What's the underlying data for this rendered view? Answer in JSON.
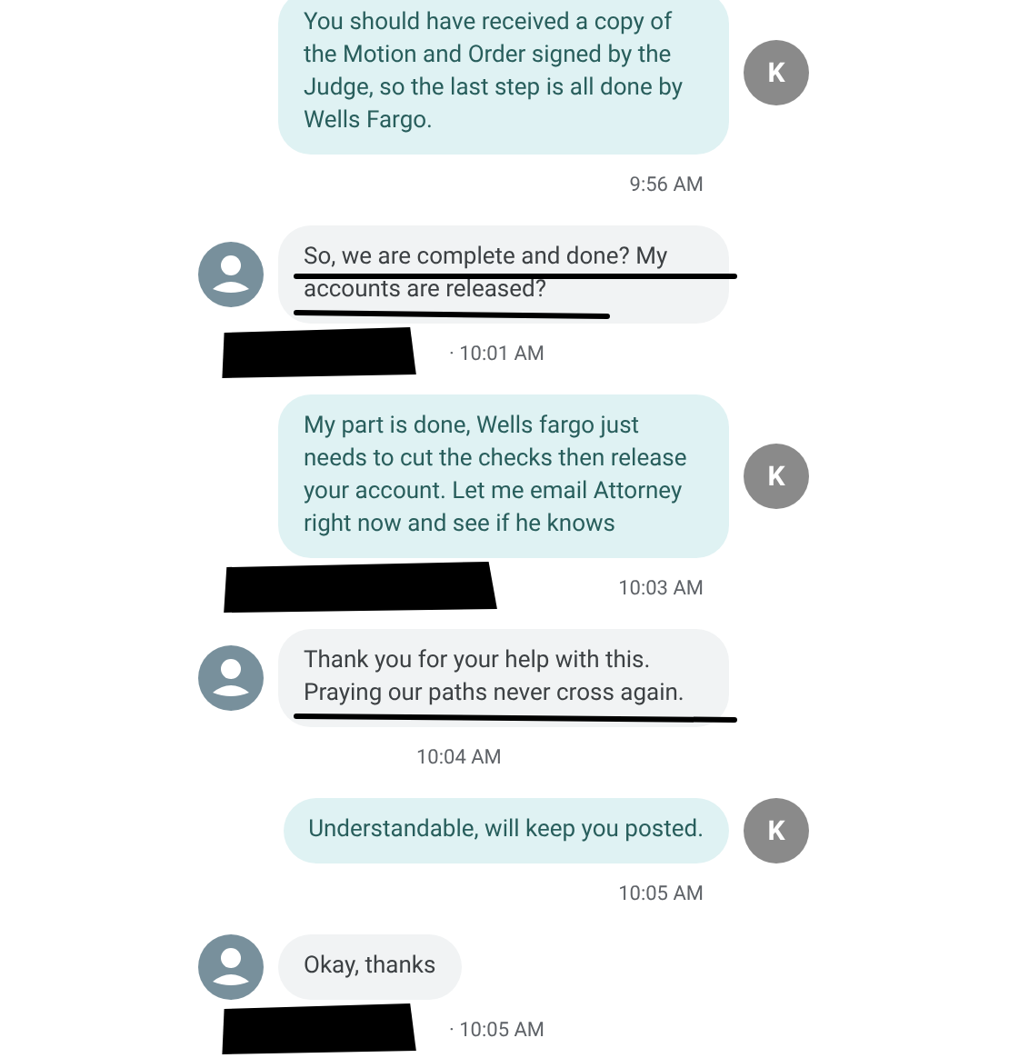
{
  "messages": [
    {
      "kind": "outgoing",
      "text": "You should have received a copy of the Motion and Order signed by the Judge, so the last step is all done by Wells Fargo.",
      "avatar": "K",
      "time": "9:56 AM",
      "redacted": false,
      "underline_first_line": false,
      "underline_last_line": false
    },
    {
      "kind": "incoming",
      "text": "So, we are complete and done? My accounts are released?",
      "time": "· 10:01 AM",
      "redacted": true,
      "underline_first_line": true,
      "underline_last_line": true
    },
    {
      "kind": "outgoing",
      "text": "My part is done, Wells fargo just needs to cut the checks then release your account. Let me email Attorney right now and see if he knows",
      "avatar": "K",
      "time": "10:03 AM",
      "redacted": true,
      "underline_first_line": false,
      "underline_last_line": false
    },
    {
      "kind": "incoming",
      "text": "Thank you for your help with this. Praying our paths never cross again.",
      "time": "10:04 AM",
      "redacted": false,
      "underline_first_line": false,
      "underline_last_line": true
    },
    {
      "kind": "outgoing",
      "text": "Understandable, will keep you posted.",
      "avatar": "K",
      "time": "10:05 AM",
      "redacted": false,
      "underline_first_line": false,
      "underline_last_line": false
    },
    {
      "kind": "incoming",
      "text": "Okay, thanks",
      "time": "· 10:05 AM",
      "redacted": true,
      "underline_first_line": false,
      "underline_last_line": false
    }
  ]
}
